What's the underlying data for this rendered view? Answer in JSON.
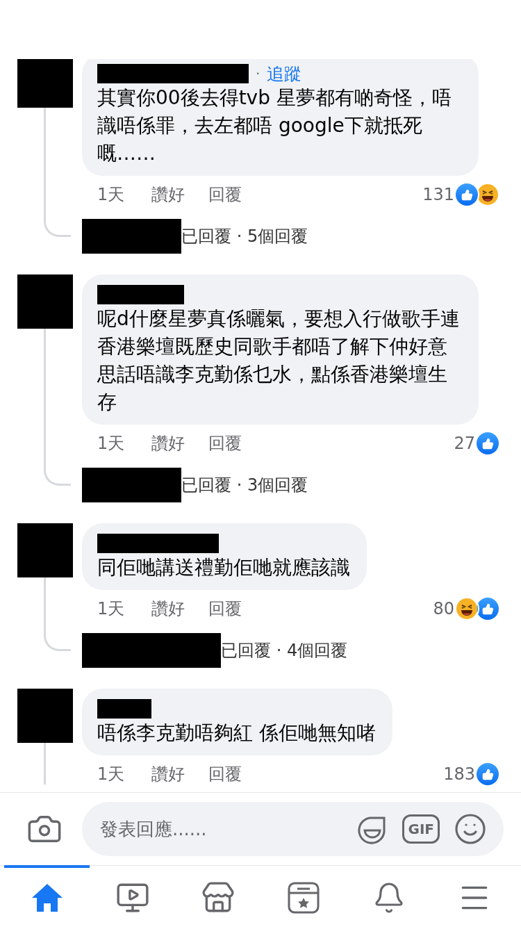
{
  "comments": [
    {
      "separator": "·",
      "follow": "追蹤",
      "text": "其實你00後去得tvb 星夢都有啲奇怪，唔識唔係罪，去左都唔 google下就抵死嘅……",
      "time": "1天",
      "like": "讚好",
      "reply": "回覆",
      "count": "131",
      "reactions": [
        {
          "kind": "like"
        },
        {
          "kind": "haha"
        }
      ],
      "replies": "已回覆 · 5個回覆"
    },
    {
      "text": "呢d什麼星夢真係曬氣，要想入行做歌手連香港樂壇既歷史同歌手都唔了解下仲好意思話唔識李克勤係乜水，點係香港樂壇生存",
      "time": "1天",
      "like": "讚好",
      "reply": "回覆",
      "count": "27",
      "reactions": [
        {
          "kind": "like"
        }
      ],
      "replies": "已回覆 · 3個回覆"
    },
    {
      "text": "同佢哋講送禮勤佢哋就應該識",
      "time": "1天",
      "like": "讚好",
      "reply": "回覆",
      "count": "80",
      "reactions": [
        {
          "kind": "haha"
        },
        {
          "kind": "like"
        }
      ],
      "replies": "已回覆 · 4個回覆"
    },
    {
      "text": "唔係李克勤唔夠紅 係佢哋無知啫",
      "time": "1天",
      "like": "讚好",
      "reply": "回覆",
      "count": "183",
      "reactions": [
        {
          "kind": "like"
        }
      ]
    }
  ],
  "composer": {
    "placeholder": "發表回應......",
    "gif": "GIF"
  },
  "tabs": [
    {
      "kind": "home",
      "selected": true
    },
    {
      "kind": "video",
      "selected": false
    },
    {
      "kind": "marketplace",
      "selected": false
    },
    {
      "kind": "favorites",
      "selected": false
    },
    {
      "kind": "notifications",
      "selected": false
    },
    {
      "kind": "menu",
      "selected": false
    }
  ]
}
